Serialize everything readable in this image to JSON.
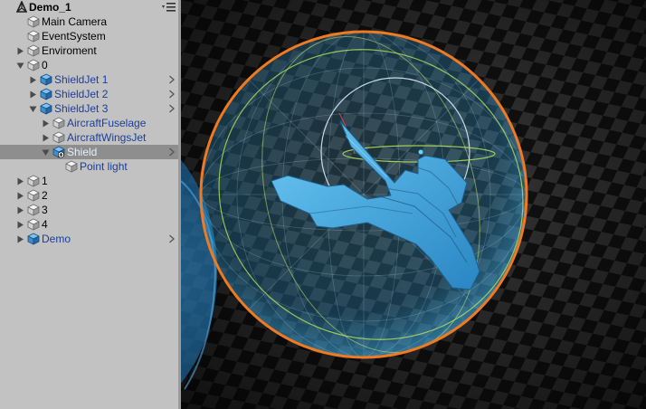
{
  "hierarchy": {
    "scene_name": "Demo_1",
    "items": [
      {
        "label": "Main Camera",
        "prefab": false,
        "fold": "none",
        "expandable": false,
        "selected": false,
        "icon": "gameobject-cube-icon"
      },
      {
        "label": "EventSystem",
        "prefab": false,
        "fold": "none",
        "expandable": false,
        "selected": false,
        "icon": "gameobject-cube-icon"
      },
      {
        "label": "Enviroment",
        "prefab": false,
        "fold": "right",
        "expandable": false,
        "selected": false,
        "icon": "gameobject-cube-icon"
      },
      {
        "label": "0",
        "prefab": false,
        "fold": "down",
        "expandable": false,
        "selected": false,
        "icon": "gameobject-cube-icon"
      },
      {
        "label": "ShieldJet 1",
        "prefab": true,
        "fold": "right",
        "expandable": true,
        "selected": false,
        "icon": "prefab-cube-icon"
      },
      {
        "label": "ShieldJet 2",
        "prefab": true,
        "fold": "right",
        "expandable": true,
        "selected": false,
        "icon": "prefab-cube-icon"
      },
      {
        "label": "ShieldJet 3",
        "prefab": true,
        "fold": "down",
        "expandable": true,
        "selected": false,
        "icon": "prefab-cube-icon"
      },
      {
        "label": "AircraftFuselage",
        "prefab": true,
        "fold": "right",
        "expandable": false,
        "selected": false,
        "icon": "gameobject-cube-icon"
      },
      {
        "label": "AircraftWingsJet",
        "prefab": true,
        "fold": "right",
        "expandable": false,
        "selected": false,
        "icon": "gameobject-cube-icon"
      },
      {
        "label": "Shield",
        "prefab": true,
        "fold": "down",
        "expandable": true,
        "selected": true,
        "icon": "prefab-cube-add-icon"
      },
      {
        "label": "Point light",
        "prefab": true,
        "fold": "none",
        "expandable": false,
        "selected": false,
        "icon": "gameobject-cube-icon"
      },
      {
        "label": "1",
        "prefab": false,
        "fold": "right",
        "expandable": false,
        "selected": false,
        "icon": "gameobject-cube-icon"
      },
      {
        "label": "2",
        "prefab": false,
        "fold": "right",
        "expandable": false,
        "selected": false,
        "icon": "gameobject-cube-icon"
      },
      {
        "label": "3",
        "prefab": false,
        "fold": "right",
        "expandable": false,
        "selected": false,
        "icon": "gameobject-cube-icon"
      },
      {
        "label": "4",
        "prefab": false,
        "fold": "right",
        "expandable": false,
        "selected": false,
        "icon": "gameobject-cube-icon"
      },
      {
        "label": "Demo",
        "prefab": true,
        "fold": "right",
        "expandable": true,
        "selected": false,
        "icon": "prefab-cube-icon"
      }
    ]
  },
  "colors": {
    "panel_bg": "#c2c2c2",
    "selected_row": "#8e8e8e",
    "prefab_text": "#1b3f98",
    "shield_outline": "#f07a22",
    "shield_fill": "#3aa8e0",
    "jet_color": "#4ab0e8",
    "gizmo_green": "#b6e35a"
  }
}
